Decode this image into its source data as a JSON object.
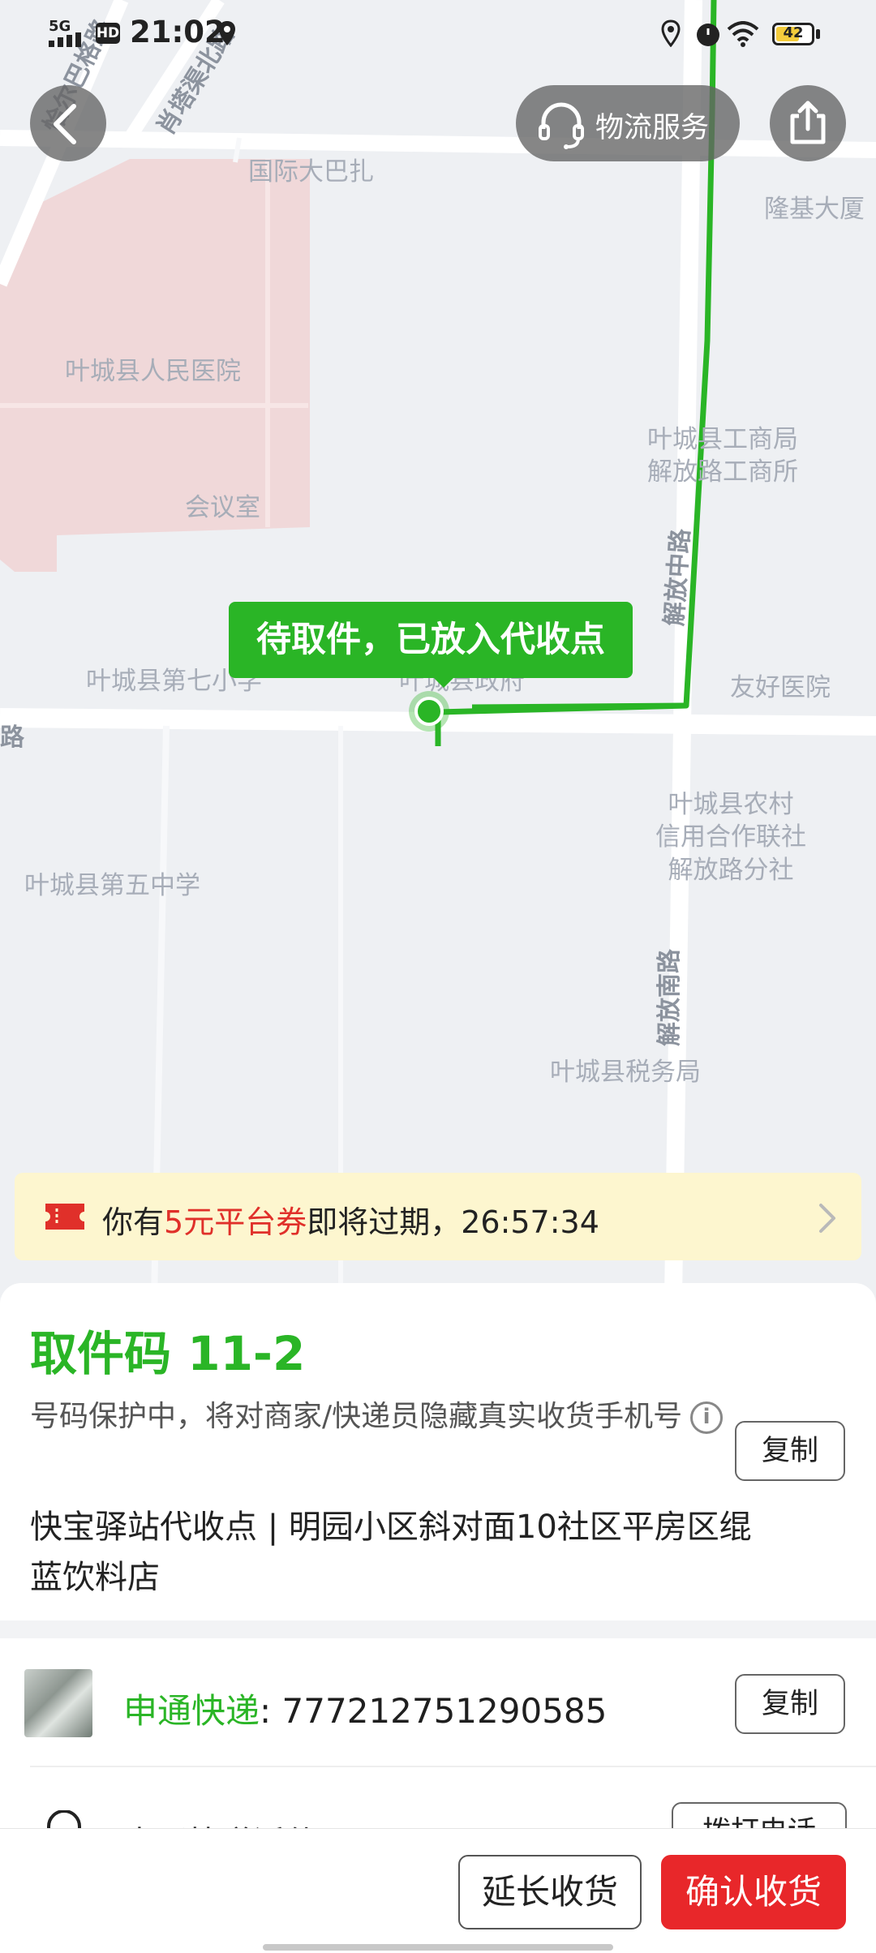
{
  "status_bar": {
    "network": "5G",
    "hd": "HD",
    "time": "21:02",
    "battery": "42"
  },
  "map": {
    "pois": {
      "intl_bazaar": "国际大巴扎",
      "longji": "隆基大厦",
      "hospital": "叶城县人民医院",
      "meeting_room": "会议室",
      "bureau_1": "叶城县工商局",
      "bureau_2": "解放路工商所",
      "school_7": "叶城县第七小学",
      "gov": "叶城县政府",
      "friendship_hospital": "友好医院",
      "credit_1": "叶城县农村",
      "credit_2": "信用合作联社",
      "credit_3": "解放路分社",
      "school_5": "叶城县第五中学",
      "tax": "叶城县税务局"
    },
    "roads": {
      "jiefang_middle": "解放中路",
      "jiefang_south": "解放南路",
      "road_a": "恰尔巴格路",
      "road_b": "肖塔渠北路",
      "road_c": "路"
    },
    "route_color": "#2ab526"
  },
  "header": {
    "logistics_service": "物流服务"
  },
  "status_bubble": "待取件，已放入代收点",
  "coupon": {
    "prefix": "你有",
    "highlight": "5元平台券",
    "suffix": "即将过期，",
    "countdown": "26:57:34"
  },
  "pickup": {
    "code_label": "取件码",
    "code": "11-2",
    "privacy_text": "号码保护中，将对商家/快递员隐藏真实收货手机号",
    "copy_label": "复制",
    "station": "快宝驿站代收点",
    "separator": " | ",
    "address": "明园小区斜对面10社区平房区绲蓝饮料店"
  },
  "tracking": {
    "carrier": "申通快递",
    "colon": ": ",
    "number": "777212751290585",
    "copy_label": "复制",
    "dispatch_text": "申通快递派件员",
    "dispatch_button": "拨打电话"
  },
  "bottom": {
    "extend_label": "延长收货",
    "confirm_label": "确认收货"
  },
  "colors": {
    "brand_green": "#2ab526",
    "confirm_red": "#e8272a",
    "coupon_bg": "#fdf6cf"
  }
}
